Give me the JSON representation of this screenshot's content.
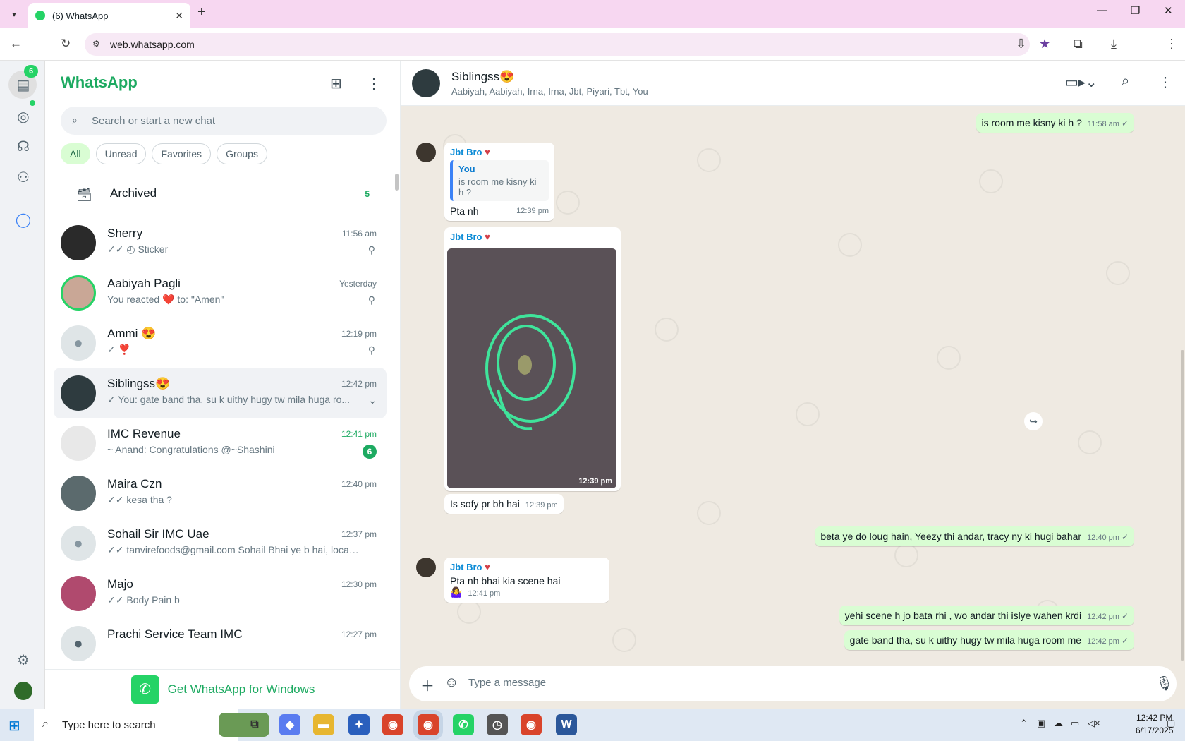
{
  "browser": {
    "tab_title": "(6) WhatsApp",
    "url": "web.whatsapp.com",
    "new_tab": "+",
    "close_tab": "✕"
  },
  "rail": {
    "chats_badge": "6",
    "icons": [
      "chats-icon",
      "status-icon",
      "channels-icon",
      "communities-icon",
      "meta-ai-icon",
      "settings-icon",
      "profile-icon"
    ]
  },
  "sidebar": {
    "brand": "WhatsApp",
    "search_placeholder": "Search or start a new chat",
    "filters": [
      "All",
      "Unread",
      "Favorites",
      "Groups"
    ],
    "archived": {
      "label": "Archived",
      "count": "5"
    },
    "chats": [
      {
        "name": "Sherry",
        "time": "11:56 am",
        "preview": "✓✓ ◴ Sticker",
        "pinned": true
      },
      {
        "name": "Aabiyah Pagli",
        "time": "Yesterday",
        "preview": "You reacted ❤️ to: \"Amen\"",
        "pinned": true
      },
      {
        "name": "Ammi 😍",
        "time": "12:19 pm",
        "preview": "✓ ❣️",
        "pinned": true
      },
      {
        "name": "Siblingss😍",
        "time": "12:42 pm",
        "preview": "✓ You: gate band tha, su k uithy hugy tw mila huga ro...",
        "selected": true
      },
      {
        "name": "IMC Revenue",
        "time": "12:41 pm",
        "preview": "~ Anand: Congratulations @~Shashini",
        "unread": "6"
      },
      {
        "name": "Maira Czn",
        "time": "12:40 pm",
        "preview": "✓✓ kesa tha ?"
      },
      {
        "name": "Sohail Sir IMC Uae",
        "time": "12:37 pm",
        "preview": "✓✓ tanvirefoods@gmail.com Sohail Bhai ye b hai, location i..."
      },
      {
        "name": "Majo",
        "time": "12:30 pm",
        "preview": "✓✓ Body Pain b"
      },
      {
        "name": "Prachi Service Team IMC",
        "time": "12:27 pm",
        "preview": ""
      }
    ],
    "promo": "Get WhatsApp for Windows"
  },
  "conversation": {
    "group_name": "Siblingss😍",
    "members": "Aabiyah, Aabiyah, Irna, Irna, Jbt, Piyari, Tbt, You",
    "messages": [
      {
        "text": "is room me kisny ki h ?",
        "time": "11:58 am"
      },
      {
        "sender": "Jbt Bro",
        "quote_name": "You",
        "quote_text": "is room me kisny ki h ?",
        "text": "Pta nh",
        "time": "12:39 pm"
      },
      {
        "sender": "Jbt Bro",
        "image_time": "12:39 pm"
      },
      {
        "text": "Is sofy pr bh hai",
        "time": "12:39 pm"
      },
      {
        "text": "beta ye do loug hain, Yeezy thi andar, tracy ny ki hugi bahar",
        "time": "12:40 pm"
      },
      {
        "sender": "Jbt Bro",
        "text": "Pta nh bhai kia scene hai🤷‍♀️",
        "time": "12:41 pm"
      },
      {
        "text": "yehi scene h jo bata rhi , wo andar thi islye wahen krdi",
        "time": "12:42 pm"
      },
      {
        "text": "gate band tha, su k uithy hugy tw mila huga room me",
        "time": "12:42 pm"
      }
    ],
    "composer_placeholder": "Type a message"
  },
  "taskbar": {
    "search_placeholder": "Type here to search",
    "time": "12:42 PM",
    "date": "6/17/2025"
  },
  "colors": {
    "accent": "#1daa61",
    "outgoing": "#d9fdd3",
    "tab_bar": "#f7d7f1"
  }
}
